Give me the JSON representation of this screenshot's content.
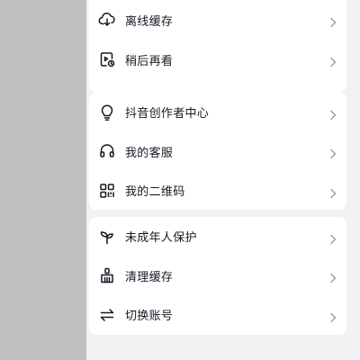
{
  "groups": [
    {
      "items": [
        {
          "label": "离线缓存",
          "icon": "cloud-download-icon"
        },
        {
          "label": "稍后再看",
          "icon": "watch-later-icon"
        }
      ]
    },
    {
      "items": [
        {
          "label": "抖音创作者中心",
          "icon": "lightbulb-icon"
        },
        {
          "label": "我的客服",
          "icon": "headset-icon"
        },
        {
          "label": "我的二维码",
          "icon": "qr-code-icon"
        }
      ]
    },
    {
      "items": [
        {
          "label": "未成年人保护",
          "icon": "sprout-icon"
        },
        {
          "label": "清理缓存",
          "icon": "broom-icon"
        },
        {
          "label": "切换账号",
          "icon": "switch-arrows-icon"
        }
      ]
    }
  ],
  "colors": {
    "text": "#161823",
    "chevron": "#9a9a9a",
    "panel_bg": "#f2f2f4",
    "overlay": "#bfbfbf"
  }
}
